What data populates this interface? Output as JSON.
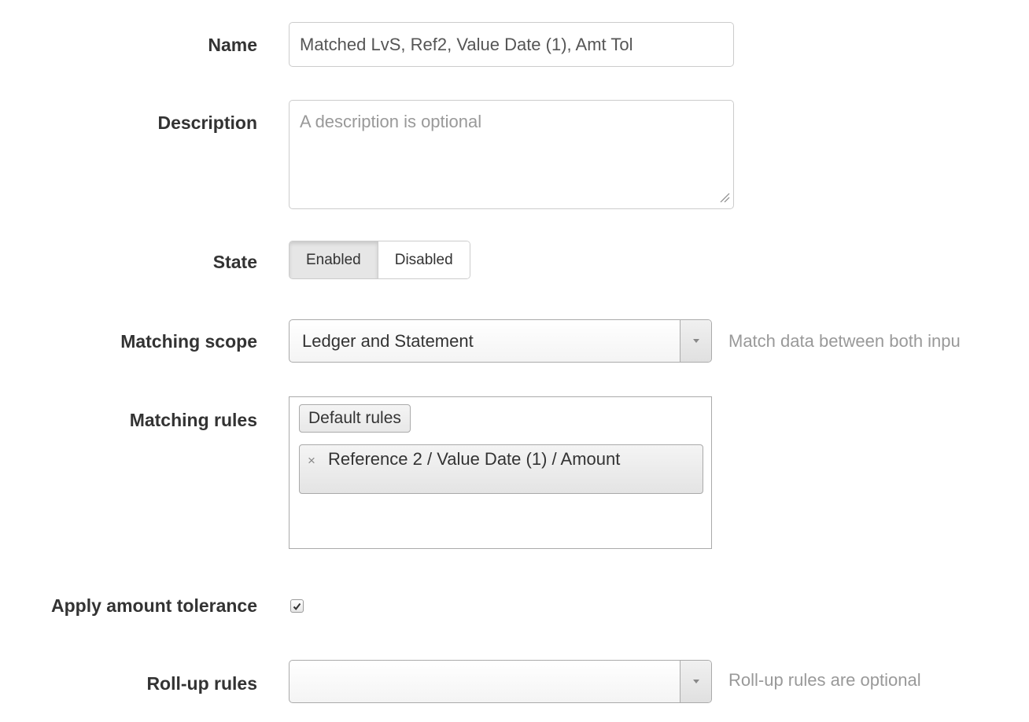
{
  "form": {
    "name": {
      "label": "Name",
      "value": "Matched LvS, Ref2, Value Date (1), Amt Tol"
    },
    "description": {
      "label": "Description",
      "placeholder": "A description is optional",
      "value": ""
    },
    "state": {
      "label": "State",
      "options": [
        "Enabled",
        "Disabled"
      ],
      "selected": "Enabled"
    },
    "matching_scope": {
      "label": "Matching scope",
      "value": "Ledger and Statement",
      "help": "Match data between both inpu"
    },
    "matching_rules": {
      "label": "Matching rules",
      "group_label": "Default rules",
      "selected_items": [
        "Reference 2 / Value Date (1) / Amount"
      ],
      "remove_symbol": "×"
    },
    "apply_amount_tolerance": {
      "label": "Apply amount tolerance",
      "checked": true
    },
    "rollup_rules": {
      "label": "Roll-up rules",
      "value": "",
      "help": "Roll-up rules are optional"
    }
  },
  "icons": {
    "dropdown": "triangle-down",
    "checkmark": "check",
    "resize": "resize-grip"
  }
}
